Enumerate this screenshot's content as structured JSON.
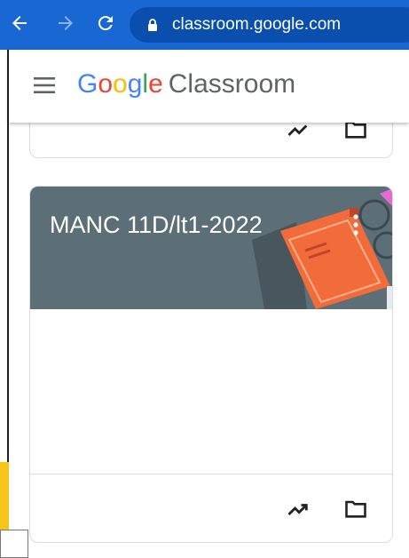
{
  "browser": {
    "url": "classroom.google.com",
    "icons": [
      "back-arrow-icon",
      "forward-arrow-icon",
      "reload-icon",
      "lock-icon"
    ]
  },
  "header": {
    "logo_letters": [
      "G",
      "o",
      "o",
      "g",
      "l",
      "e"
    ],
    "logo_colors": [
      "#4285f4",
      "#ea4335",
      "#fbbc04",
      "#4285f4",
      "#34a853",
      "#ea4335"
    ],
    "product_name": "Classroom",
    "menu_icon": "hamburger-menu-icon"
  },
  "cards": [
    {
      "title": "MANC 11D/lt1-2022",
      "banner_color": "#5c6f77",
      "icons": [
        "more-vert-icon",
        "trending-up-icon",
        "folder-icon"
      ]
    }
  ],
  "colors": {
    "browser_bar": "#1967d2",
    "accent_book": "#f26b3a"
  }
}
